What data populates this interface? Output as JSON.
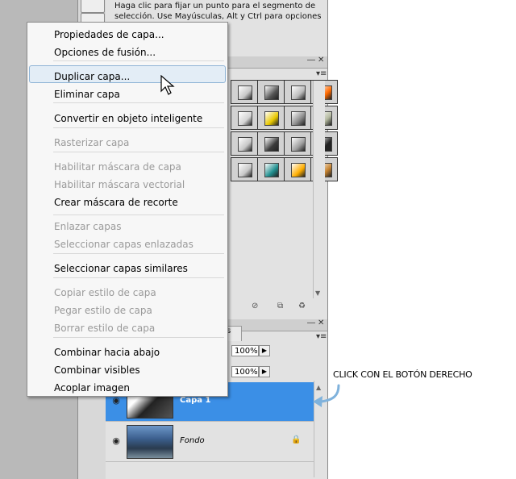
{
  "help_text": "Haga clic para fijar un punto para el segmento de selección. Use Mayúsculas, Alt y Ctrl para opciones",
  "menu": {
    "items": [
      {
        "label": "Propiedades de capa...",
        "enabled": true
      },
      {
        "label": "Opciones de fusión...",
        "enabled": true
      },
      {
        "label": "Duplicar capa...",
        "enabled": true,
        "highlighted": true
      },
      {
        "label": "Eliminar capa",
        "enabled": true
      },
      {
        "label": "Convertir en objeto inteligente",
        "enabled": true
      },
      {
        "label": "Rasterizar capa",
        "enabled": false
      },
      {
        "label": "Habilitar máscara de capa",
        "enabled": false
      },
      {
        "label": "Habilitar máscara vectorial",
        "enabled": false
      },
      {
        "label": "Crear máscara de recorte",
        "enabled": true
      },
      {
        "label": "Enlazar capas",
        "enabled": false
      },
      {
        "label": "Seleccionar capas enlazadas",
        "enabled": false
      },
      {
        "label": "Seleccionar capas similares",
        "enabled": true
      },
      {
        "label": "Copiar estilo de capa",
        "enabled": false
      },
      {
        "label": "Pegar estilo de capa",
        "enabled": false
      },
      {
        "label": "Borrar estilo de capa",
        "enabled": false
      },
      {
        "label": "Combinar hacia abajo",
        "enabled": true
      },
      {
        "label": "Combinar visibles",
        "enabled": true
      },
      {
        "label": "Acoplar imagen",
        "enabled": true
      }
    ]
  },
  "layers_panel": {
    "tab_fragment": "os",
    "opacity": "100%",
    "fill": "100%",
    "layers": [
      {
        "name": "Capa 1",
        "selected": true,
        "locked": false
      },
      {
        "name": "Fondo",
        "selected": false,
        "locked": true
      }
    ]
  },
  "styles_colors": {
    "row1": [
      "#c8c8c8",
      "#555555",
      "#bcbcbc",
      "#ff6a00"
    ],
    "row2": [
      "#d4d4d4",
      "#e8c800",
      "#8a8a8a",
      "#b6bba2"
    ],
    "row3": [
      "#c8c8c8",
      "#3a3a3a",
      "#9e9e9e",
      "#222222"
    ],
    "row4": [
      "#c8c8c8",
      "#1f8f8f",
      "#ffae00",
      "#c78431"
    ]
  },
  "selected_layer_color": "#3b8fe6",
  "annotation": "CLICK CON EL BOTÓN DERECHO"
}
